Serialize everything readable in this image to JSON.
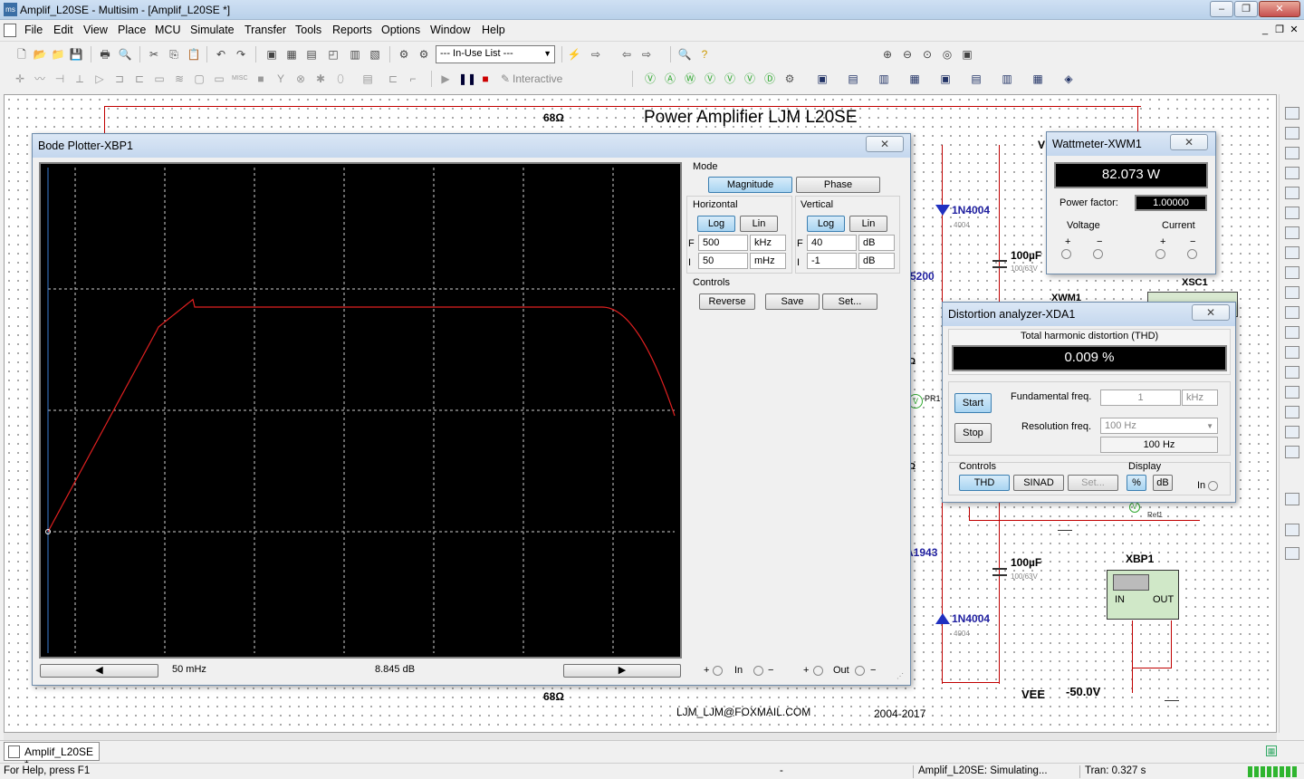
{
  "window": {
    "title": "Amplif_L20SE - Multisim - [Amplif_L20SE *]",
    "app_icon": "multisim-icon"
  },
  "menu": [
    "File",
    "Edit",
    "View",
    "Place",
    "MCU",
    "Simulate",
    "Transfer",
    "Tools",
    "Reports",
    "Options",
    "Window",
    "Help"
  ],
  "toolbar": {
    "in_use_list": "--- In-Use List ---",
    "interactive_label": "Interactive"
  },
  "schematic": {
    "title": "Power Amplifier LJM L20SE",
    "r_top": "68Ω",
    "r_bottom": "68Ω",
    "vee_label": "VEE",
    "vee_value": "-50.0V",
    "email": "LJM_LJM@FOXMAIL.COM",
    "years": "2004-2017",
    "diode1": "1N4004",
    "diode1_sub": "4004",
    "diode2": "1N4004",
    "diode2_sub": "4004",
    "cap1": "100µF",
    "cap1_sub": "100/63V",
    "cap2": "100µF",
    "cap2_sub": "100/63V",
    "part_5200": "5200",
    "part_1943": "A1943",
    "xsc1": "XSC1",
    "xwm1": "XWM1",
    "xbp1": "XBP1",
    "xbp1_in": "IN",
    "xbp1_out": "OUT",
    "ref1": "Ref1",
    "pr1": "PR1",
    "ohm_a": "Ω",
    "ohm_b": "Ω",
    "v_label": "V"
  },
  "bode": {
    "title": "Bode Plotter-XBP1",
    "mode_label": "Mode",
    "magnitude_btn": "Magnitude",
    "phase_btn": "Phase",
    "horizontal_label": "Horizontal",
    "vertical_label": "Vertical",
    "log_btn": "Log",
    "lin_btn": "Lin",
    "h_f_prefix": "F",
    "h_f_value": "500",
    "h_f_unit": "kHz",
    "h_i_prefix": "I",
    "h_i_value": "50",
    "h_i_unit": "mHz",
    "v_f_prefix": "F",
    "v_f_value": "40",
    "v_f_unit": "dB",
    "v_i_prefix": "I",
    "v_i_value": "-1",
    "v_i_unit": "dB",
    "controls_label": "Controls",
    "reverse_btn": "Reverse",
    "save_btn": "Save",
    "set_btn": "Set...",
    "cursor_freq": "50 mHz",
    "cursor_db": "8.845 dB",
    "in_label": "In",
    "out_label": "Out",
    "plus": "+",
    "minus": "−",
    "trace_color": "#e02020"
  },
  "wattmeter": {
    "title": "Wattmeter-XWM1",
    "reading": "82.073 W",
    "pf_label": "Power factor:",
    "pf_value": "1.00000",
    "voltage_label": "Voltage",
    "current_label": "Current",
    "plus": "+",
    "minus": "−"
  },
  "distortion": {
    "title": "Distortion analyzer-XDA1",
    "thd_heading": "Total harmonic distortion (THD)",
    "thd_value": "0.009 %",
    "start_btn": "Start",
    "stop_btn": "Stop",
    "fund_label": "Fundamental freq.",
    "fund_value": "1",
    "fund_unit": "kHz",
    "res_label": "Resolution freq.",
    "res_select": "100 Hz",
    "res_value": "100 Hz",
    "controls_label": "Controls",
    "display_label": "Display",
    "thd_btn": "THD",
    "sinad_btn": "SINAD",
    "set_btn": "Set...",
    "pct_btn": "%",
    "db_btn": "dB",
    "in_label": "In"
  },
  "tabs": {
    "doc_tab": "Amplif_L20SE *"
  },
  "status": {
    "help": "For Help, press F1",
    "dash": "-",
    "sim": "Amplif_L20SE: Simulating...",
    "tran": "Tran: 0.327 s"
  }
}
